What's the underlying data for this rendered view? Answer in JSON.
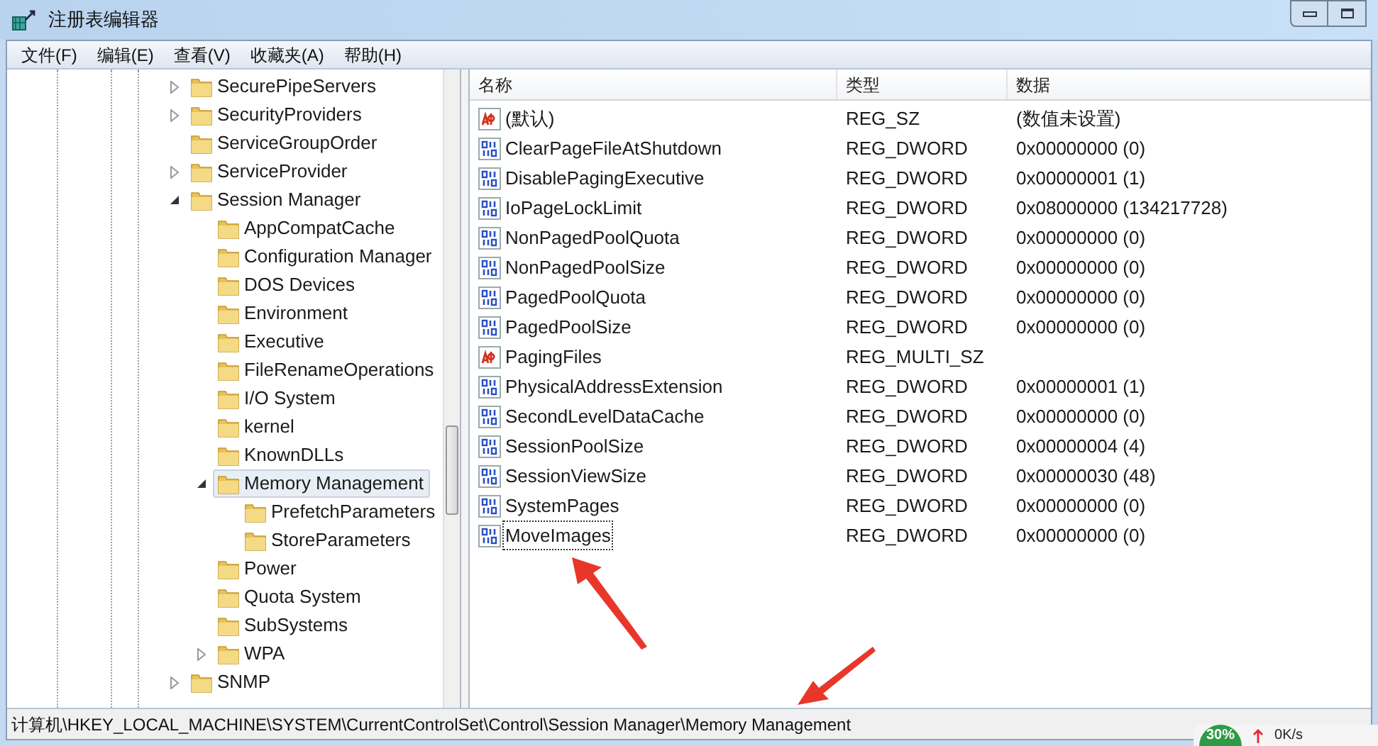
{
  "window": {
    "title": "注册表编辑器"
  },
  "menu": [
    "文件(F)",
    "编辑(E)",
    "查看(V)",
    "收藏夹(A)",
    "帮助(H)"
  ],
  "tree": [
    {
      "label": "SecurePipeServers",
      "expanded": false,
      "selected": false
    },
    {
      "label": "SecurityProviders",
      "expanded": false,
      "selected": false
    },
    {
      "label": "ServiceGroupOrder",
      "selected": false
    },
    {
      "label": "ServiceProvider",
      "expanded": false,
      "selected": false
    },
    {
      "label": "Session Manager",
      "expanded": true,
      "selected": false,
      "children": [
        {
          "label": "AppCompatCache",
          "selected": false
        },
        {
          "label": "Configuration Manager",
          "selected": false
        },
        {
          "label": "DOS Devices",
          "selected": false
        },
        {
          "label": "Environment",
          "selected": false
        },
        {
          "label": "Executive",
          "selected": false
        },
        {
          "label": "FileRenameOperations",
          "selected": false
        },
        {
          "label": "I/O System",
          "selected": false
        },
        {
          "label": "kernel",
          "selected": false
        },
        {
          "label": "KnownDLLs",
          "selected": false
        },
        {
          "label": "Memory Management",
          "expanded": true,
          "selected": true,
          "children": [
            {
              "label": "PrefetchParameters",
              "selected": false
            },
            {
              "label": "StoreParameters",
              "selected": false
            }
          ]
        },
        {
          "label": "Power",
          "selected": false
        },
        {
          "label": "Quota System",
          "selected": false
        },
        {
          "label": "SubSystems",
          "selected": false
        },
        {
          "label": "WPA",
          "expanded": false,
          "selected": false
        }
      ]
    },
    {
      "label": "SNMP",
      "expanded": false,
      "selected": false
    }
  ],
  "columns": [
    "名称",
    "类型",
    "数据"
  ],
  "values": [
    {
      "kind": "string",
      "name": "(默认)",
      "type": "REG_SZ",
      "data": "(数值未设置)",
      "focused": false
    },
    {
      "kind": "dword",
      "name": "ClearPageFileAtShutdown",
      "type": "REG_DWORD",
      "data": "0x00000000 (0)",
      "focused": false
    },
    {
      "kind": "dword",
      "name": "DisablePagingExecutive",
      "type": "REG_DWORD",
      "data": "0x00000001 (1)",
      "focused": false
    },
    {
      "kind": "dword",
      "name": "IoPageLockLimit",
      "type": "REG_DWORD",
      "data": "0x08000000 (134217728)",
      "focused": false
    },
    {
      "kind": "dword",
      "name": "NonPagedPoolQuota",
      "type": "REG_DWORD",
      "data": "0x00000000 (0)",
      "focused": false
    },
    {
      "kind": "dword",
      "name": "NonPagedPoolSize",
      "type": "REG_DWORD",
      "data": "0x00000000 (0)",
      "focused": false
    },
    {
      "kind": "dword",
      "name": "PagedPoolQuota",
      "type": "REG_DWORD",
      "data": "0x00000000 (0)",
      "focused": false
    },
    {
      "kind": "dword",
      "name": "PagedPoolSize",
      "type": "REG_DWORD",
      "data": "0x00000000 (0)",
      "focused": false
    },
    {
      "kind": "string",
      "name": "PagingFiles",
      "type": "REG_MULTI_SZ",
      "focused": false
    },
    {
      "kind": "dword",
      "name": "PhysicalAddressExtension",
      "type": "REG_DWORD",
      "data": "0x00000001 (1)",
      "focused": false
    },
    {
      "kind": "dword",
      "name": "SecondLevelDataCache",
      "type": "REG_DWORD",
      "data": "0x00000000 (0)",
      "focused": false
    },
    {
      "kind": "dword",
      "name": "SessionPoolSize",
      "type": "REG_DWORD",
      "data": "0x00000004 (4)",
      "focused": false
    },
    {
      "kind": "dword",
      "name": "SessionViewSize",
      "type": "REG_DWORD",
      "data": "0x00000030 (48)",
      "focused": false
    },
    {
      "kind": "dword",
      "name": "SystemPages",
      "type": "REG_DWORD",
      "data": "0x00000000 (0)",
      "focused": false
    },
    {
      "kind": "dword",
      "name": "MoveImages",
      "type": "REG_DWORD",
      "data": "0x00000000 (0)",
      "focused": true
    }
  ],
  "status_bar": "计算机\\HKEY_LOCAL_MACHINE\\SYSTEM\\CurrentControlSet\\Control\\Session Manager\\Memory Management",
  "net_widget": {
    "percent": "30%",
    "speed": "0K/s"
  }
}
